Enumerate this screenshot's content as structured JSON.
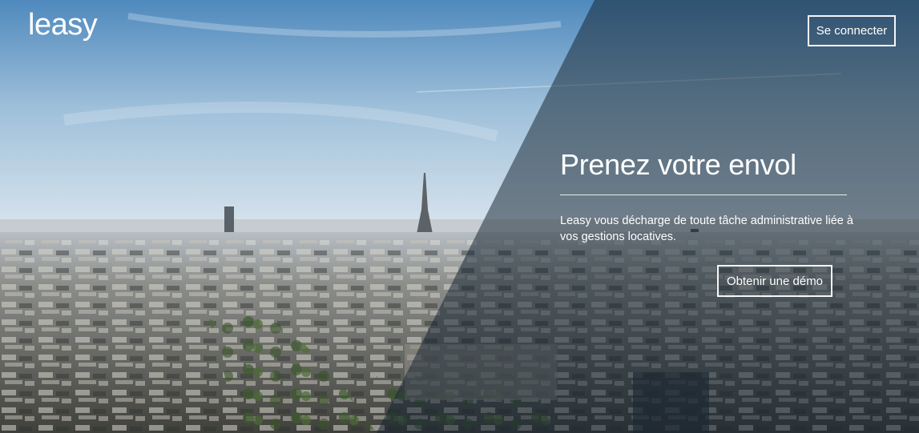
{
  "brand": {
    "logo_text": "leasy"
  },
  "header": {
    "login_label": "Se connecter"
  },
  "hero": {
    "title": "Prenez votre envol",
    "subtitle": "Leasy vous décharge de toute tâche administrative liée à vos gestions locatives.",
    "cta_label": "Obtenir une démo",
    "background": "Paris skyline with Eiffel Tower"
  },
  "colors": {
    "text": "#ffffff",
    "overlay": "#142330",
    "sky_top": "#5f95c4",
    "sky_bottom": "#e8eef2"
  }
}
